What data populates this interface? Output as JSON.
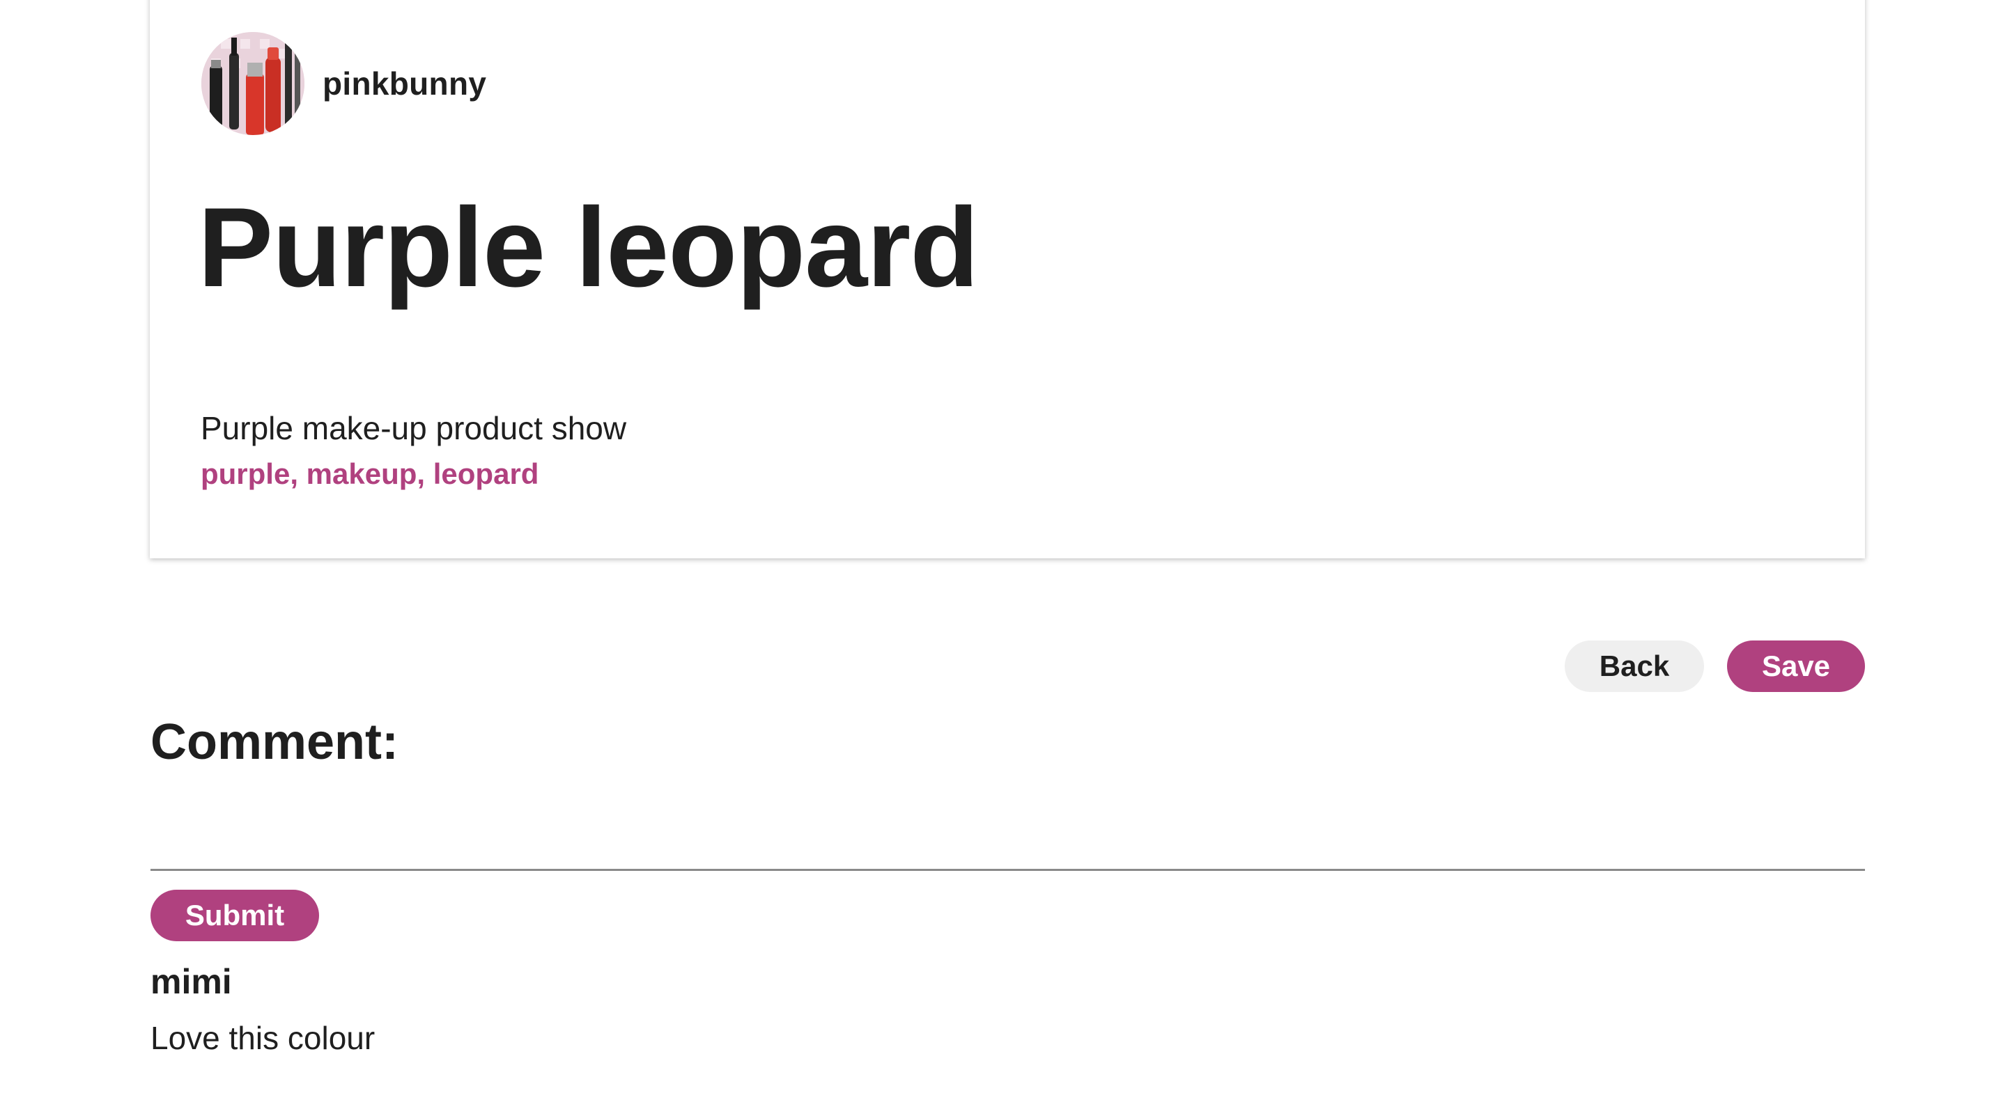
{
  "pin": {
    "author": "pinkbunny",
    "title": "Purple leopard",
    "description": "Purple make-up product show",
    "tags": "purple, makeup, leopard"
  },
  "actions": {
    "back_label": "Back",
    "save_label": "Save"
  },
  "comments": {
    "heading": "Comment:",
    "input_value": "",
    "submit_label": "Submit",
    "items": [
      {
        "author": "mimi",
        "text": "Love this colour"
      }
    ]
  },
  "theme": {
    "accent": "#b0417f",
    "secondary_button": "#efefef",
    "text": "#1f1f1f"
  },
  "icons": {
    "avatar": "makeup-product-avatar"
  }
}
